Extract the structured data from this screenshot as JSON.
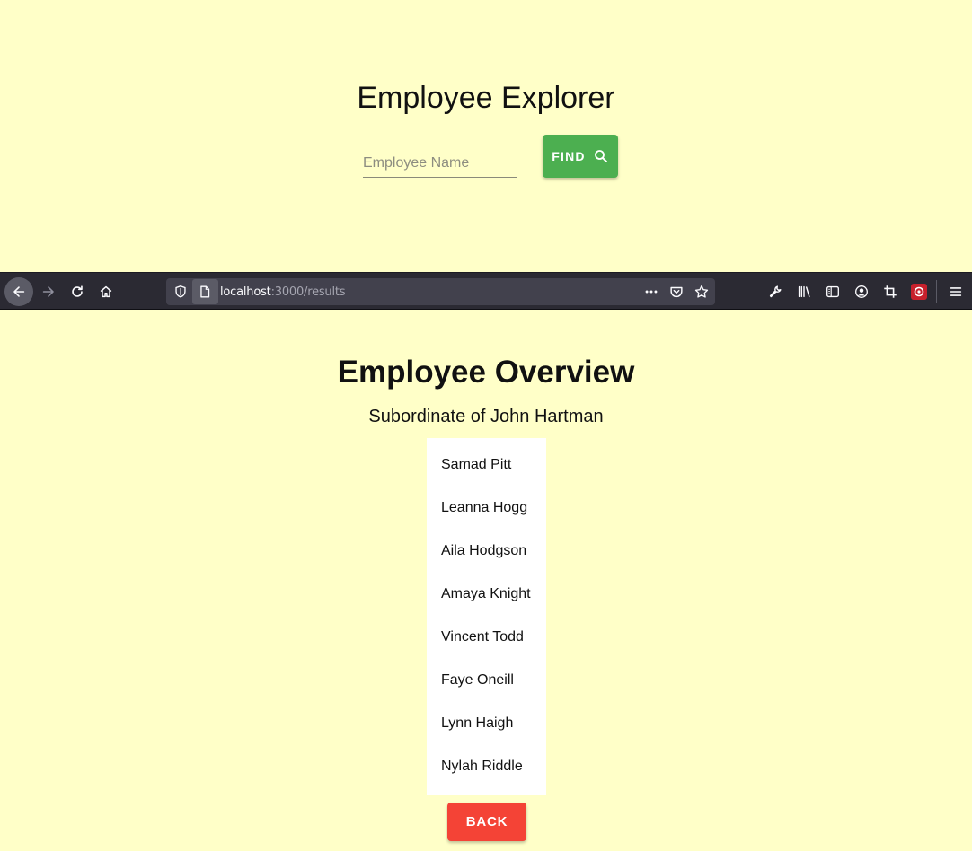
{
  "explorer": {
    "title": "Employee Explorer",
    "search_placeholder": "Employee Name",
    "search_value": "",
    "find_label": "FIND"
  },
  "browser": {
    "url_host": "localhost",
    "url_rest": ":3000/results",
    "icons": [
      "back-arrow-icon",
      "forward-arrow-icon",
      "reload-icon",
      "home-icon",
      "shield-icon",
      "page-icon",
      "more-dots-icon",
      "pocket-icon",
      "star-icon",
      "wrench-icon",
      "library-icon",
      "sidebar-icon",
      "account-icon",
      "screenshot-icon",
      "extension-icon",
      "menu-icon"
    ]
  },
  "overview": {
    "title": "Employee Overview",
    "subtitle": "Subordinate of John Hartman",
    "employees": [
      "Samad Pitt",
      "Leanna Hogg",
      "Aila Hodgson",
      "Amaya Knight",
      "Vincent Todd",
      "Faye Oneill",
      "Lynn Haigh",
      "Nylah Riddle"
    ],
    "back_label": "BACK"
  },
  "colors": {
    "background": "#ffffc8",
    "find_button": "#4caf50",
    "back_button": "#f44336",
    "toolbar": "#2b2a33"
  }
}
